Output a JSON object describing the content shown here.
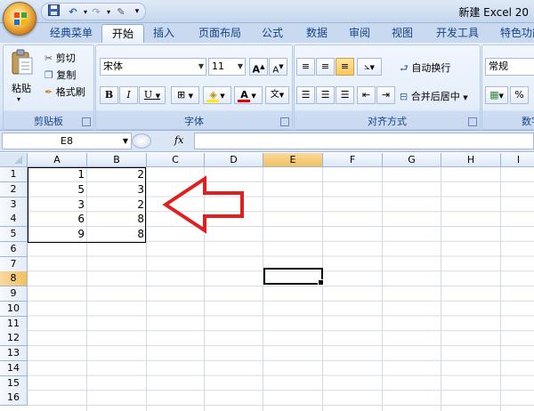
{
  "title": {
    "text": "新建 Excel 20"
  },
  "quick_access": {
    "save_icon": "save-icon",
    "undo_icon": "undo-icon",
    "redo_icon": "redo-icon",
    "customize_icon": "chevron-down-icon"
  },
  "tabs": [
    {
      "label": "经典菜单",
      "active": false
    },
    {
      "label": "开始",
      "active": true
    },
    {
      "label": "插入",
      "active": false
    },
    {
      "label": "页面布局",
      "active": false
    },
    {
      "label": "公式",
      "active": false
    },
    {
      "label": "数据",
      "active": false
    },
    {
      "label": "审阅",
      "active": false
    },
    {
      "label": "视图",
      "active": false
    },
    {
      "label": "开发工具",
      "active": false
    },
    {
      "label": "特色功能",
      "active": false
    }
  ],
  "ribbon": {
    "clipboard": {
      "label": "剪贴板",
      "paste": "粘贴",
      "cut": "剪切",
      "copy": "复制",
      "format_painter": "格式刷"
    },
    "font": {
      "label": "字体",
      "font_name": "宋体",
      "font_size": "11",
      "bold": "B",
      "italic": "I",
      "underline": "U",
      "grow": "A",
      "shrink": "A",
      "font_color_letter": "A",
      "phonetic": "文"
    },
    "alignment": {
      "label": "对齐方式",
      "wrap_text": "自动换行",
      "merge_center": "合并后居中"
    },
    "number": {
      "label": "数字",
      "format": "常规",
      "percent": "%"
    }
  },
  "formula_bar": {
    "name_box": "E8",
    "fx": "fx",
    "value": ""
  },
  "sheet": {
    "columns": [
      "A",
      "B",
      "C",
      "D",
      "E",
      "F",
      "G",
      "H",
      "I"
    ],
    "active_column": "E",
    "rows": [
      "1",
      "2",
      "3",
      "4",
      "5",
      "6",
      "7",
      "8",
      "9",
      "10",
      "11",
      "12",
      "13",
      "14",
      "15",
      "16"
    ],
    "active_row": "8",
    "active_cell": "E8",
    "data": [
      [
        "1",
        "2"
      ],
      [
        "5",
        "3"
      ],
      [
        "3",
        "2"
      ],
      [
        "6",
        "8"
      ],
      [
        "9",
        "8"
      ]
    ],
    "arrow_color": "#e02020"
  }
}
